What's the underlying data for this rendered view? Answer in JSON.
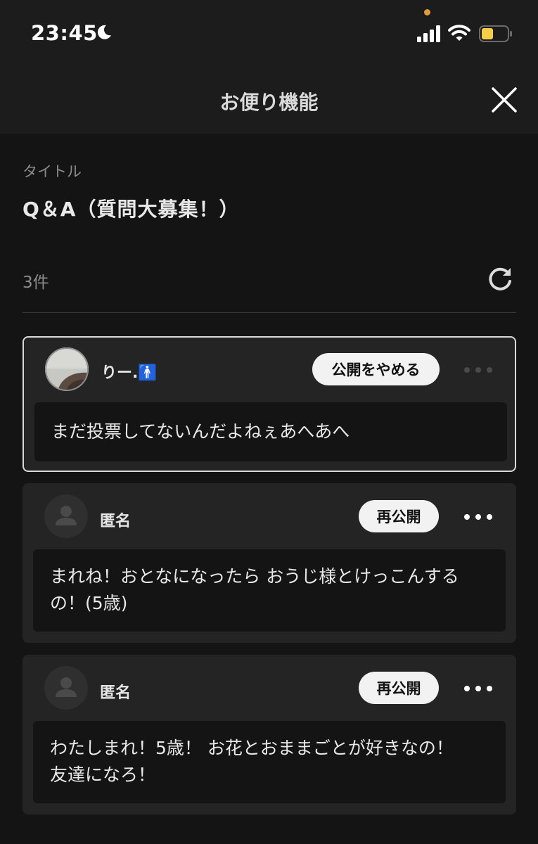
{
  "status_bar": {
    "time": "23:45",
    "icons": [
      "moon-icon",
      "cellular-signal-icon",
      "wifi-icon",
      "battery-icon"
    ],
    "battery_color": "#f5cd47",
    "indicator_color": "#e39a3c"
  },
  "header": {
    "title": "お便り機能",
    "close_icon": "close-icon"
  },
  "letter": {
    "title_label": "タイトル",
    "title_value": "Q＆A（質問大募集！）"
  },
  "list": {
    "count_label": "3件",
    "refresh_icon": "refresh-icon",
    "items": [
      {
        "username": "りー.🚹",
        "action_label": "公開をやめる",
        "message_lines": [
          "まだ投票してないんだよねぇあへあへ"
        ],
        "selected": true
      },
      {
        "username": "匿名",
        "action_label": "再公開",
        "message_lines": [
          "まれね！おとなになったら おうじ様とけっこんする",
          "の！(5歳)"
        ],
        "selected": false
      },
      {
        "username": "匿名",
        "action_label": "再公開",
        "message_lines": [
          "わたしまれ！5歳！ お花とおままごとが好きなの！",
          "友達になろ！"
        ],
        "selected": false
      }
    ]
  },
  "colors": {
    "background": "#141414",
    "card": "#242424",
    "pill": "#f2f2f2",
    "selected_border": "#d9d9d9"
  }
}
